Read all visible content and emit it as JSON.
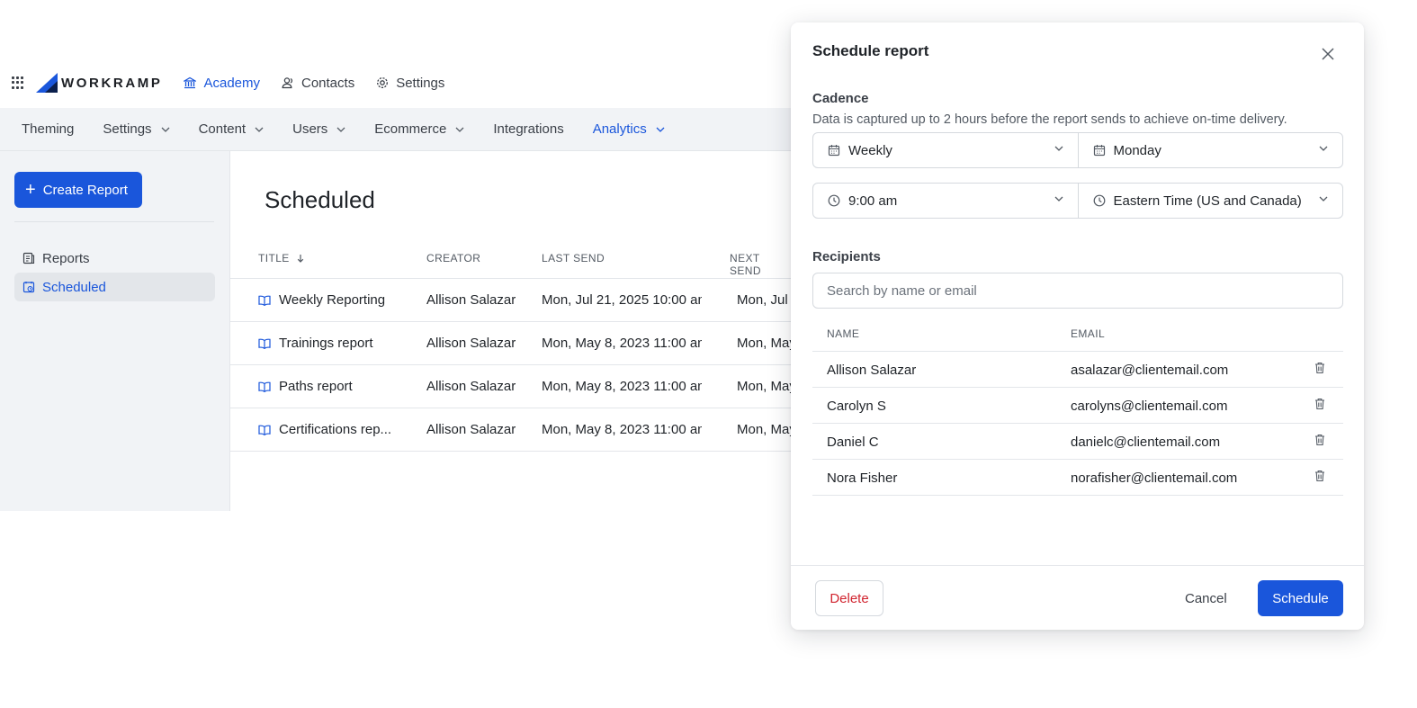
{
  "brand": {
    "name": "WORKRAMP",
    "accent": "#1a56db"
  },
  "topnav": [
    {
      "label": "Academy",
      "icon": "bank-icon",
      "active": true
    },
    {
      "label": "Contacts",
      "icon": "users-icon",
      "active": false
    },
    {
      "label": "Settings",
      "icon": "gear-icon",
      "active": false
    }
  ],
  "subnav": [
    {
      "label": "Theming"
    },
    {
      "label": "Settings"
    },
    {
      "label": "Content"
    },
    {
      "label": "Users"
    },
    {
      "label": "Ecommerce"
    },
    {
      "label": "Integrations"
    },
    {
      "label": "Analytics"
    }
  ],
  "sidebar": {
    "create_label": "Create Report",
    "items": [
      {
        "label": "Reports"
      },
      {
        "label": "Scheduled"
      }
    ]
  },
  "main": {
    "title": "Scheduled",
    "columns": [
      "TITLE",
      "CREATOR",
      "LAST SEND",
      "NEXT SEND"
    ],
    "rows": [
      {
        "title": "Weekly Reporting",
        "creator": "Allison Salazar",
        "last_send": "Mon, Jul 21, 2025 10:00 am",
        "next_send": "Mon, Jul"
      },
      {
        "title": "Trainings report",
        "creator": "Allison Salazar",
        "last_send": "Mon, May 8, 2023 11:00 am",
        "next_send": "Mon, May"
      },
      {
        "title": "Paths report",
        "creator": "Allison Salazar",
        "last_send": "Mon, May 8, 2023 11:00 am",
        "next_send": "Mon, May"
      },
      {
        "title": "Certifications rep...",
        "creator": "Allison Salazar",
        "last_send": "Mon, May 8, 2023 11:00 am",
        "next_send": "Mon, May"
      }
    ]
  },
  "modal": {
    "title": "Schedule report",
    "cadence_label": "Cadence",
    "cadence_help": "Data is captured up to 2 hours before the report sends to achieve on-time delivery.",
    "frequency": "Weekly",
    "day": "Monday",
    "time": "9:00 am",
    "timezone": "Eastern Time (US and Canada)",
    "recipients_label": "Recipients",
    "search_placeholder": "Search by name or email",
    "columns": [
      "NAME",
      "EMAIL"
    ],
    "recipients": [
      {
        "name": "Allison Salazar",
        "email": "asalazar@clientemail.com"
      },
      {
        "name": "Carolyn S",
        "email": "carolyns@clientemail.com"
      },
      {
        "name": "Daniel C",
        "email": "danielc@clientemail.com"
      },
      {
        "name": "Nora Fisher",
        "email": "norafisher@clientemail.com"
      }
    ],
    "delete_label": "Delete",
    "cancel_label": "Cancel",
    "schedule_label": "Schedule"
  }
}
